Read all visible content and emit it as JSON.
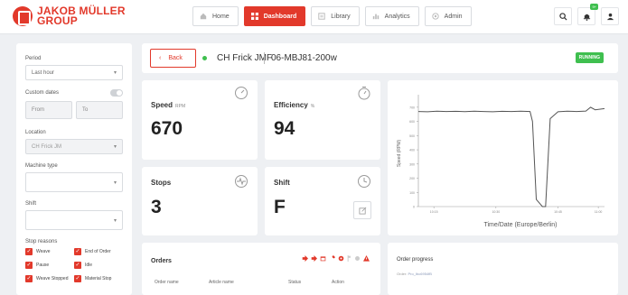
{
  "brand": {
    "line1": "JAKOB MÜLLER",
    "line2": "GROUP",
    "color": "#e2392b"
  },
  "nav": [
    {
      "label": "Home",
      "icon": "home-icon",
      "active": false
    },
    {
      "label": "Dashboard",
      "icon": "dashboard-icon",
      "active": true
    },
    {
      "label": "Library",
      "icon": "library-icon",
      "active": false
    },
    {
      "label": "Analytics",
      "icon": "analytics-icon",
      "active": false
    },
    {
      "label": "Admin",
      "icon": "admin-icon",
      "active": false
    }
  ],
  "header_icons": {
    "search": "search-icon",
    "bell": "bell-icon",
    "bell_badge": "9+",
    "user": "user-icon"
  },
  "sidebar": {
    "period_label": "Period",
    "period_value": "Last hour",
    "custom_dates_label": "Custom dates",
    "from_placeholder": "From",
    "to_placeholder": "To",
    "location_label": "Location",
    "location_value": "CH Frick JM",
    "machine_type_label": "Machine type",
    "shift_label": "Shift",
    "stop_reasons_label": "Stop reasons",
    "checkboxes": [
      "Weave",
      "End of Order",
      "Pause",
      "Idle",
      "Weave Stopped",
      "Material Stop"
    ]
  },
  "topbar": {
    "back_label": "Back",
    "machine_name": "CH Frick JMF",
    "machine_id": "06-MBJ81-200w",
    "status": "RUNNING",
    "status_color": "#3fbf4f"
  },
  "kpis": {
    "speed": {
      "title": "Speed",
      "unit": "RPM",
      "value": "670"
    },
    "efficiency": {
      "title": "Efficiency",
      "unit": "%",
      "value": "94"
    },
    "stops": {
      "title": "Stops",
      "value": "3"
    },
    "shift": {
      "title": "Shift",
      "value": "F"
    }
  },
  "chart_data": {
    "type": "line",
    "ylabel": "Speed (RPM)",
    "xlabel": "Time/Date (Europe/Berlin)",
    "yticks": [
      "0",
      "100",
      "200",
      "300",
      "400",
      "500",
      "600",
      "700"
    ],
    "xticks": [
      "10:15",
      "10:30",
      "10:45",
      "11:00"
    ],
    "ylim": [
      0,
      750
    ],
    "xlim": [
      0,
      60
    ],
    "x": [
      0,
      3,
      6,
      9,
      12,
      15,
      18,
      21,
      24,
      27,
      30,
      33,
      36,
      36.8,
      38,
      40,
      41,
      42.5,
      45,
      48,
      51,
      54,
      55.5,
      57,
      60
    ],
    "values": [
      670,
      668,
      672,
      670,
      671,
      669,
      672,
      670,
      668,
      671,
      670,
      672,
      670,
      600,
      50,
      0,
      0,
      620,
      668,
      672,
      670,
      673,
      700,
      682,
      690
    ],
    "color": "#555555"
  },
  "orders": {
    "title": "Orders",
    "columns": [
      "Order name",
      "Article name",
      "Status",
      "Action"
    ],
    "icon_color": "#e2392b"
  },
  "order_progress": {
    "title": "Order progress",
    "label": "Order:",
    "value": "Pro_Ibc6954fB"
  }
}
